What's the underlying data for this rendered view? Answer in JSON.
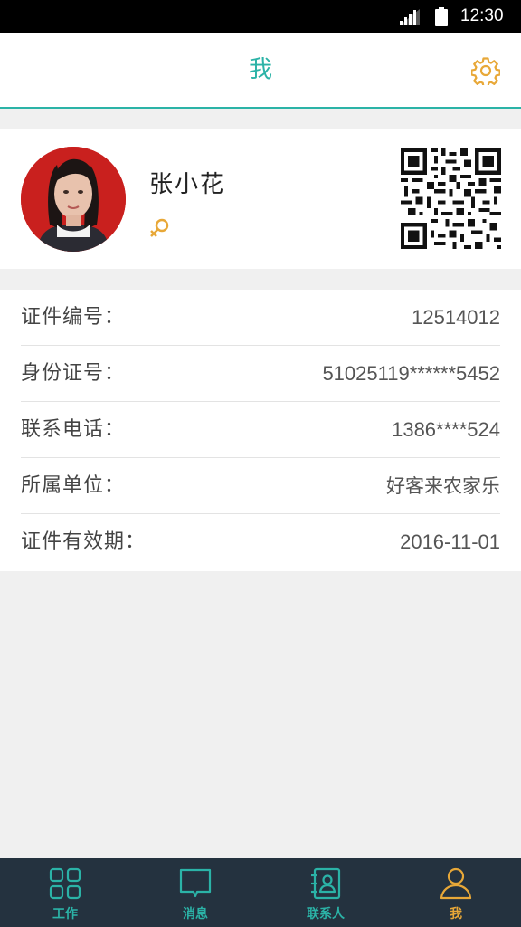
{
  "status_bar": {
    "time": "12:30"
  },
  "header": {
    "title": "我",
    "settings_icon": "gear-icon"
  },
  "profile": {
    "name": "张小花",
    "gender_icon": "female-symbol-icon",
    "qr_icon": "qr-code-icon"
  },
  "info": {
    "rows": [
      {
        "label": "证件编号：",
        "value": "12514012"
      },
      {
        "label": "身份证号：",
        "value": "51025119******5452"
      },
      {
        "label": "联系电话：",
        "value": "1386****524"
      },
      {
        "label": "所属单位：",
        "value": "好客来农家乐"
      },
      {
        "label": "证件有效期：",
        "value": "2016-11-01"
      }
    ]
  },
  "tabbar": {
    "items": [
      {
        "label": "工作",
        "icon": "grid-icon",
        "active": false
      },
      {
        "label": "消息",
        "icon": "chat-bubble-icon",
        "active": false
      },
      {
        "label": "联系人",
        "icon": "contacts-book-icon",
        "active": false
      },
      {
        "label": "我",
        "icon": "person-icon",
        "active": true
      }
    ]
  },
  "colors": {
    "accent": "#2bb3a7",
    "active_tab": "#e8a838",
    "tabbar_bg": "#24323f",
    "gear": "#e8a838"
  }
}
